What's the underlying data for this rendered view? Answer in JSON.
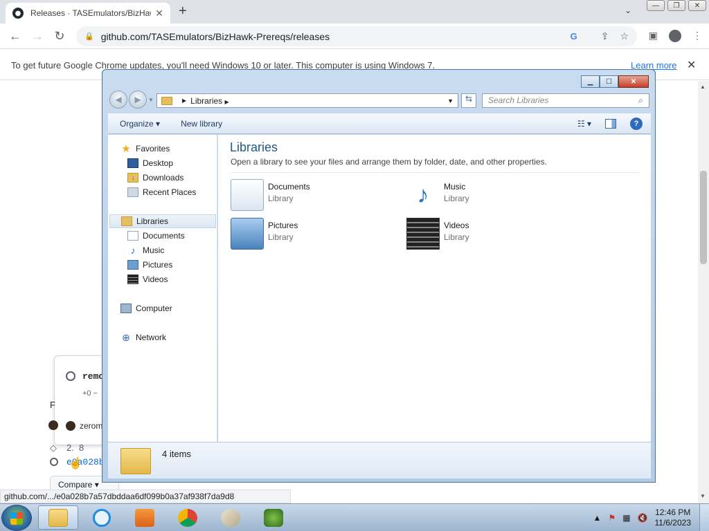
{
  "browser": {
    "tab_title": "Releases · TASEmulators/BizHawk",
    "tab_close": "✕",
    "new_tab": "+",
    "url": "github.com/TASEmulators/BizHawk-Prereqs/releases",
    "infobar_message": "To get future Google Chrome updates, you'll need Windows 10 or later. This computer is using Windows 7.",
    "infobar_link": "Learn more",
    "infobar_close": "✕",
    "status_url": "github.com/.../e0a028b7a57dbddaa6df099b0a37af938f7da9d8"
  },
  "background_page": {
    "commit_text": "remo",
    "diff_text": "+0 −",
    "letter": "F",
    "user": "zerom",
    "tag": "2.",
    "tag_tail": "8",
    "commit_hash": "e0a028b",
    "compare_label": "Compare"
  },
  "explorer": {
    "breadcrumb": "Libraries",
    "search_placeholder": "Search Libraries",
    "organize": "Organize",
    "new_library": "New library",
    "heading": "Libraries",
    "subheading": "Open a library to see your files and arrange them by folder, date, and other properties.",
    "tree": {
      "favorites": "Favorites",
      "desktop": "Desktop",
      "downloads": "Downloads",
      "recent": "Recent Places",
      "libraries": "Libraries",
      "documents": "Documents",
      "music": "Music",
      "pictures": "Pictures",
      "videos": "Videos",
      "computer": "Computer",
      "network": "Network"
    },
    "libs": [
      {
        "name": "Documents",
        "kind": "Library",
        "icon": "documents-library-icon"
      },
      {
        "name": "Music",
        "kind": "Library",
        "icon": "music-library-icon"
      },
      {
        "name": "Pictures",
        "kind": "Library",
        "icon": "pictures-library-icon"
      },
      {
        "name": "Videos",
        "kind": "Library",
        "icon": "videos-library-icon"
      }
    ],
    "item_count": "4 items"
  },
  "taskbar": {
    "time": "12:46 PM",
    "date": "11/6/2023",
    "apps": [
      "explorer-icon",
      "internet-explorer-icon",
      "media-player-icon",
      "chrome-icon",
      "paint-icon",
      "emulator-icon"
    ]
  },
  "colors": {
    "accent_link": "#1a73e8",
    "explorer_heading": "#1e5a87",
    "window_frame": "#b3cce6"
  }
}
